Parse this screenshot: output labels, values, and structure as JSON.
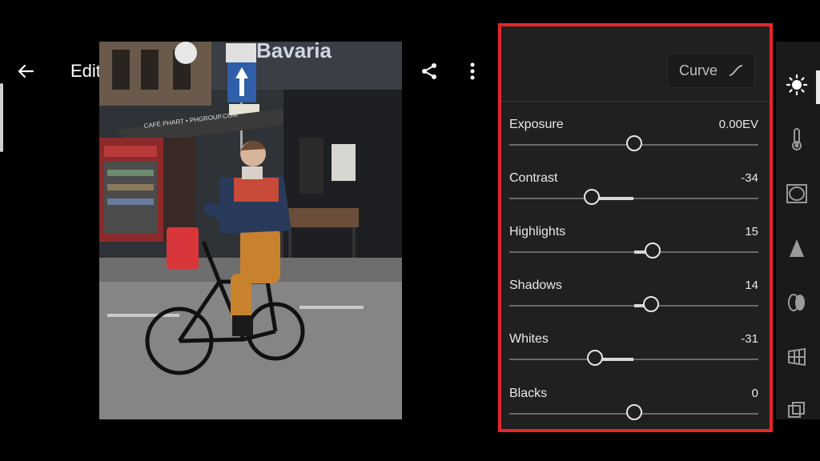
{
  "toolbar": {
    "edit_label": "Edit"
  },
  "photo": {
    "sign_text": "Bavaria",
    "awning_text": "CAFÉ PHART • PHGROUP.COM"
  },
  "panel": {
    "curve_label": "Curve",
    "adjustments": [
      {
        "label": "Exposure",
        "value": "0.00EV",
        "level": 0.5
      },
      {
        "label": "Contrast",
        "value": "-34",
        "level": 0.33
      },
      {
        "label": "Highlights",
        "value": "15",
        "level": 0.575
      },
      {
        "label": "Shadows",
        "value": "14",
        "level": 0.57
      },
      {
        "label": "Whites",
        "value": "-31",
        "level": 0.345
      },
      {
        "label": "Blacks",
        "value": "0",
        "level": 0.5
      }
    ]
  },
  "colors": {
    "highlight_border": "#e8262a",
    "panel_bg": "#202020"
  },
  "tools": [
    "light-icon",
    "color-icon",
    "vignette-icon",
    "detail-icon",
    "optics-icon",
    "geometry-icon"
  ]
}
